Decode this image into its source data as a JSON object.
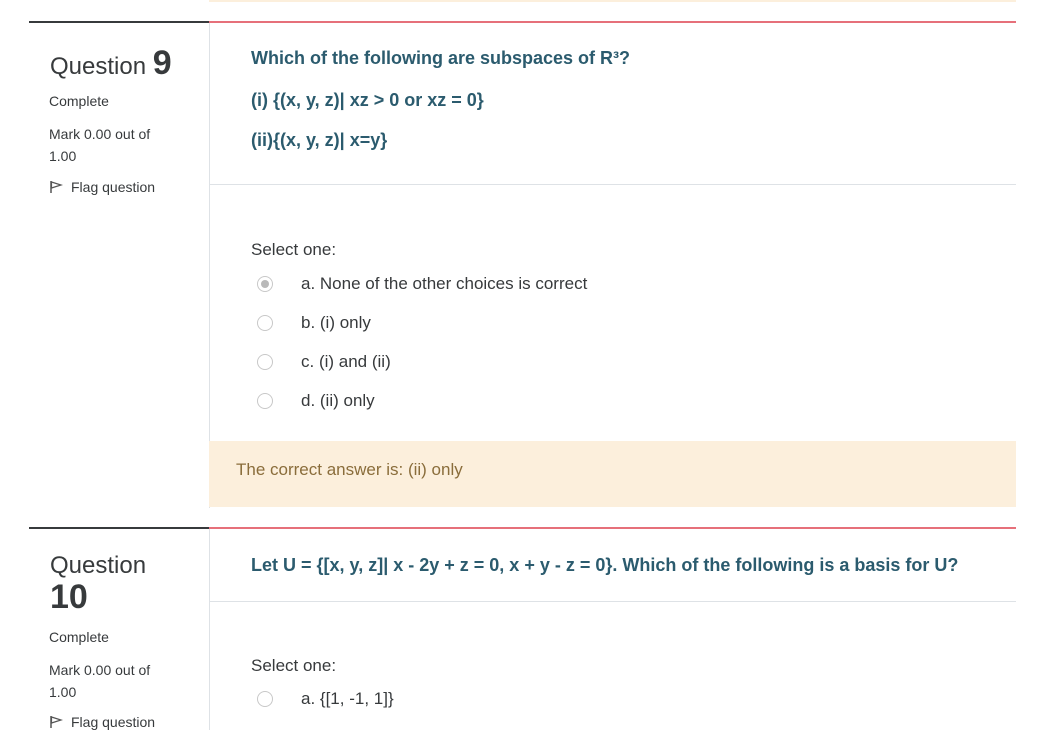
{
  "q9": {
    "word": "Question",
    "number": "9",
    "state": "Complete",
    "mark_line1": "Mark 0.00 out of",
    "mark_line2": "1.00",
    "flag": "Flag question",
    "text_line1": "Which of the following are subspaces of R³?",
    "text_line2": "(i) {(x, y, z)| xz > 0 or xz = 0}",
    "text_line3": "(ii){(x, y, z)| x=y}",
    "prompt": "Select one:",
    "options": [
      {
        "label": "a. None of the other choices is correct",
        "selected": true
      },
      {
        "label": "b. (i) only",
        "selected": false
      },
      {
        "label": "c. (i) and (ii)",
        "selected": false
      },
      {
        "label": "d. (ii) only",
        "selected": false
      }
    ],
    "feedback": "The correct answer is: (ii) only"
  },
  "q10": {
    "word": "Question",
    "number": "10",
    "state": "Complete",
    "mark_line1": "Mark 0.00 out of",
    "mark_line2": "1.00",
    "flag": "Flag question",
    "text": "Let U = {[x, y, z]| x - 2y + z = 0, x + y - z = 0}. Which of the following is a basis for U?",
    "prompt": "Select one:",
    "options": [
      {
        "label": "a. {[1, -1, 1]}",
        "selected": false
      }
    ]
  },
  "colors": {
    "accent": "#e6707a",
    "question_text": "#2b5b6e",
    "feedback_bg": "#fcefdc"
  }
}
